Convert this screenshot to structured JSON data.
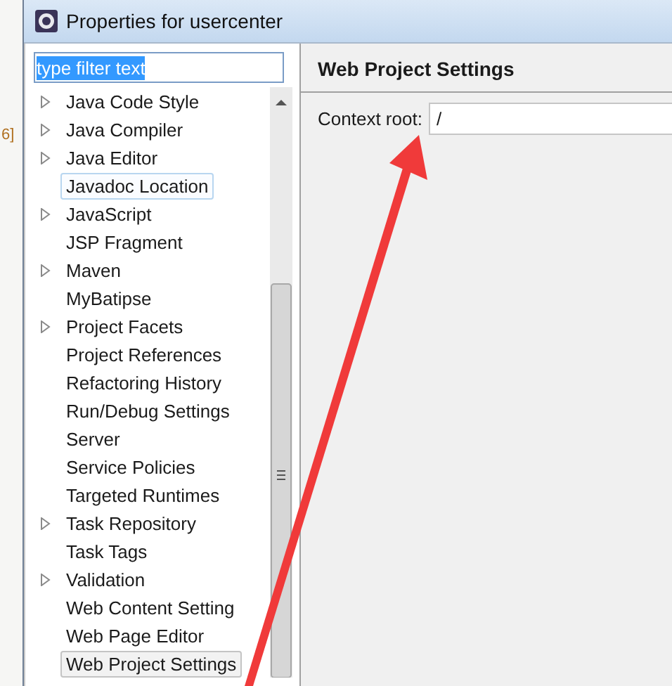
{
  "background_window": {
    "text_fragment": "6]"
  },
  "window": {
    "title": "Properties for usercenter"
  },
  "filter": {
    "value": "type filter text",
    "text_selected": true
  },
  "tree": {
    "items": [
      {
        "label": "Java Code Style",
        "expandable": true,
        "selected": false,
        "hovered": false
      },
      {
        "label": "Java Compiler",
        "expandable": true,
        "selected": false,
        "hovered": false
      },
      {
        "label": "Java Editor",
        "expandable": true,
        "selected": false,
        "hovered": false
      },
      {
        "label": "Javadoc Location",
        "expandable": false,
        "selected": false,
        "hovered": true
      },
      {
        "label": "JavaScript",
        "expandable": true,
        "selected": false,
        "hovered": false
      },
      {
        "label": "JSP Fragment",
        "expandable": false,
        "selected": false,
        "hovered": false
      },
      {
        "label": "Maven",
        "expandable": true,
        "selected": false,
        "hovered": false
      },
      {
        "label": "MyBatipse",
        "expandable": false,
        "selected": false,
        "hovered": false
      },
      {
        "label": "Project Facets",
        "expandable": true,
        "selected": false,
        "hovered": false
      },
      {
        "label": "Project References",
        "expandable": false,
        "selected": false,
        "hovered": false
      },
      {
        "label": "Refactoring History",
        "expandable": false,
        "selected": false,
        "hovered": false
      },
      {
        "label": "Run/Debug Settings",
        "expandable": false,
        "selected": false,
        "hovered": false
      },
      {
        "label": "Server",
        "expandable": false,
        "selected": false,
        "hovered": false
      },
      {
        "label": "Service Policies",
        "expandable": false,
        "selected": false,
        "hovered": false
      },
      {
        "label": "Targeted Runtimes",
        "expandable": false,
        "selected": false,
        "hovered": false
      },
      {
        "label": "Task Repository",
        "expandable": true,
        "selected": false,
        "hovered": false
      },
      {
        "label": "Task Tags",
        "expandable": false,
        "selected": false,
        "hovered": false
      },
      {
        "label": "Validation",
        "expandable": true,
        "selected": false,
        "hovered": false
      },
      {
        "label": "Web Content Setting",
        "expandable": false,
        "selected": false,
        "hovered": false
      },
      {
        "label": "Web Page Editor",
        "expandable": false,
        "selected": false,
        "hovered": false
      },
      {
        "label": "Web Project Settings",
        "expandable": false,
        "selected": true,
        "hovered": false
      }
    ]
  },
  "page": {
    "title": "Web Project Settings",
    "fields": [
      {
        "label": "Context root:",
        "value": "/"
      }
    ]
  },
  "annotation": {
    "kind": "arrow"
  }
}
